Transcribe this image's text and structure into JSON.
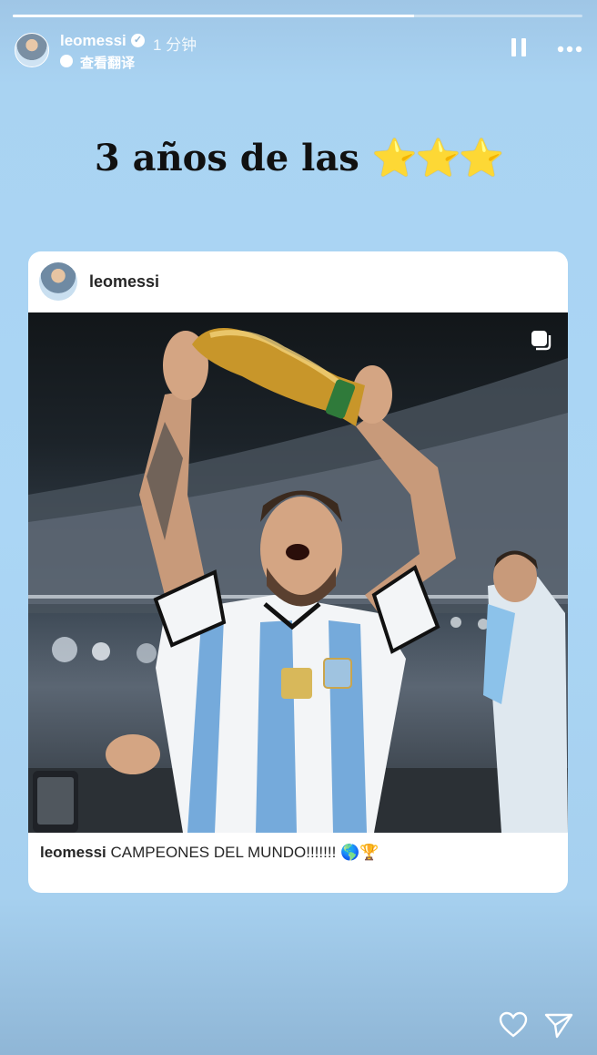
{
  "story": {
    "progress": 0.705,
    "username": "leomessi",
    "time": "1 分钟",
    "translate_label": "查看翻译"
  },
  "headline": {
    "text": "3 años de las",
    "stars": "⭐⭐⭐"
  },
  "post": {
    "username": "leomessi",
    "caption_user": "leomessi",
    "caption_text": "CAMPEONES DEL MUNDO!!!!!!! 🌎🏆"
  },
  "colors": {
    "background": "#abd6f5",
    "trophy": "#c8962a",
    "jersey_stripe": "#75aadb"
  },
  "icons": {
    "verified": "verified-badge-icon",
    "translate": "translate-icon",
    "pause": "pause-icon",
    "more": "more-icon",
    "multi_photo": "multi-photo-icon",
    "like": "heart-icon",
    "share": "share-icon"
  }
}
